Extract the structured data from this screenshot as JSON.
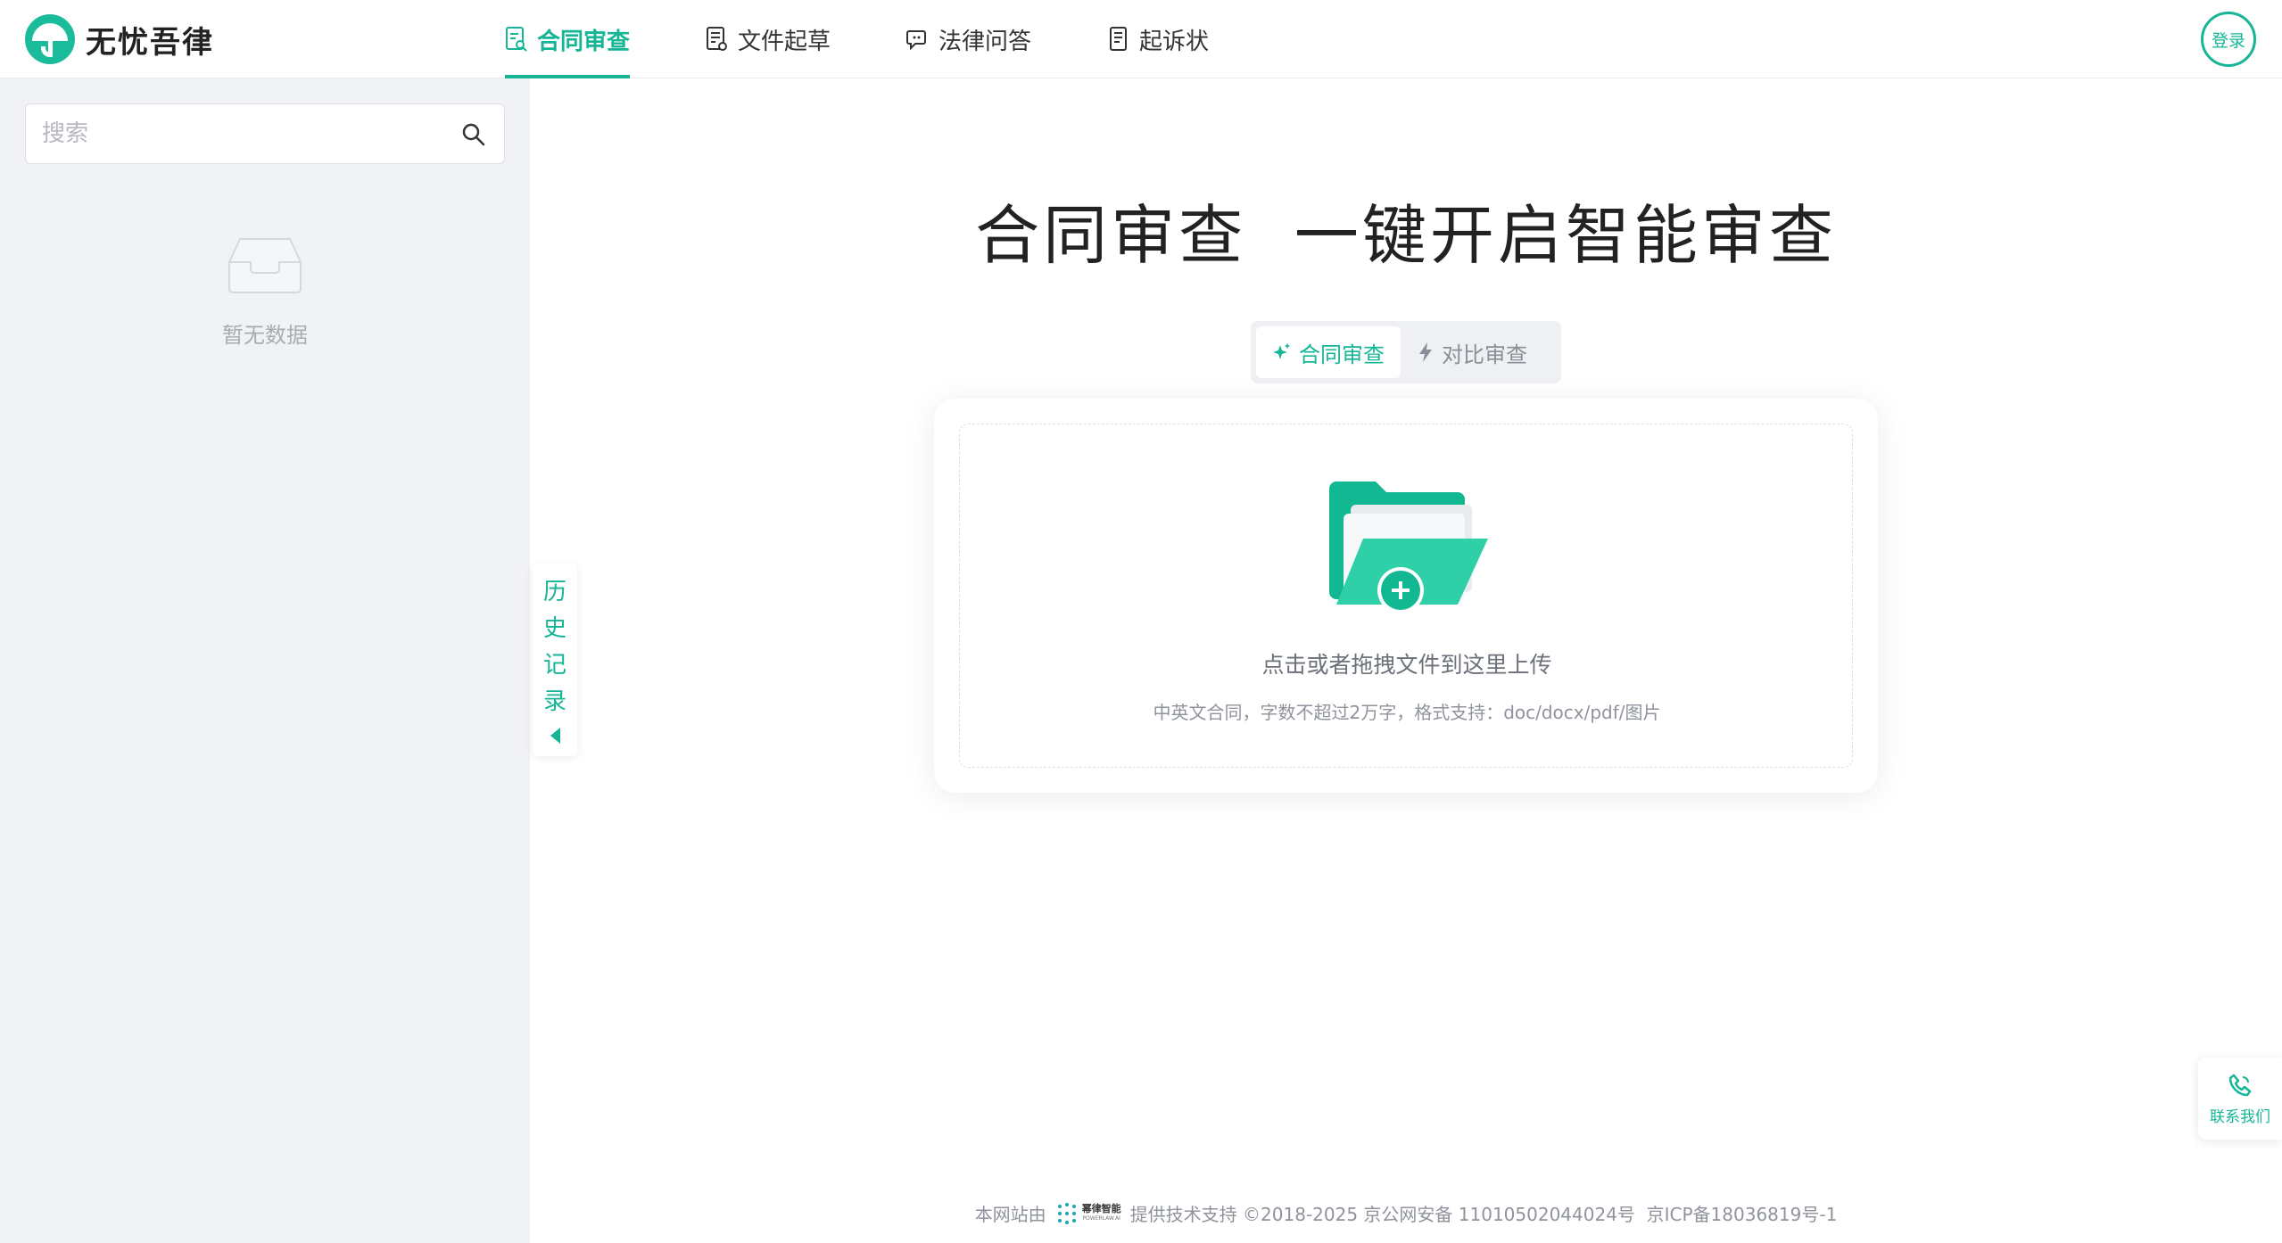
{
  "app": {
    "name": "无忧吾律",
    "login_label": "登录"
  },
  "nav": {
    "items": [
      {
        "label": "合同审查",
        "icon": "contract-review-icon",
        "active": true
      },
      {
        "label": "文件起草",
        "icon": "document-draft-icon",
        "active": false
      },
      {
        "label": "法律问答",
        "icon": "legal-qa-icon",
        "active": false
      },
      {
        "label": "起诉状",
        "icon": "complaint-icon",
        "active": false
      }
    ]
  },
  "sidebar": {
    "search_placeholder": "搜索",
    "empty_text": "暂无数据",
    "history_chars": [
      "历",
      "史",
      "记",
      "录"
    ]
  },
  "main": {
    "title": "合同审查  一键开启智能审查",
    "modes": [
      {
        "label": "合同审查",
        "icon": "sparkle-icon",
        "active": true
      },
      {
        "label": "对比审查",
        "icon": "lightning-icon",
        "active": false
      }
    ],
    "upload_main": "点击或者拖拽文件到这里上传",
    "upload_sub": "中英文合同，字数不超过2万字，格式支持：doc/docx/pdf/图片"
  },
  "contact": {
    "label": "联系我们"
  },
  "footer": {
    "prefix": "本网站由",
    "brand": "幂律智能",
    "brand_sub": "POWERLAW.AI",
    "suffix": "提供技术支持 ©2018-2025 京公网安备 11010502044024号  京ICP备18036819号-1"
  },
  "colors": {
    "accent": "#15b596",
    "sidebar_bg": "#f1f2f5"
  }
}
